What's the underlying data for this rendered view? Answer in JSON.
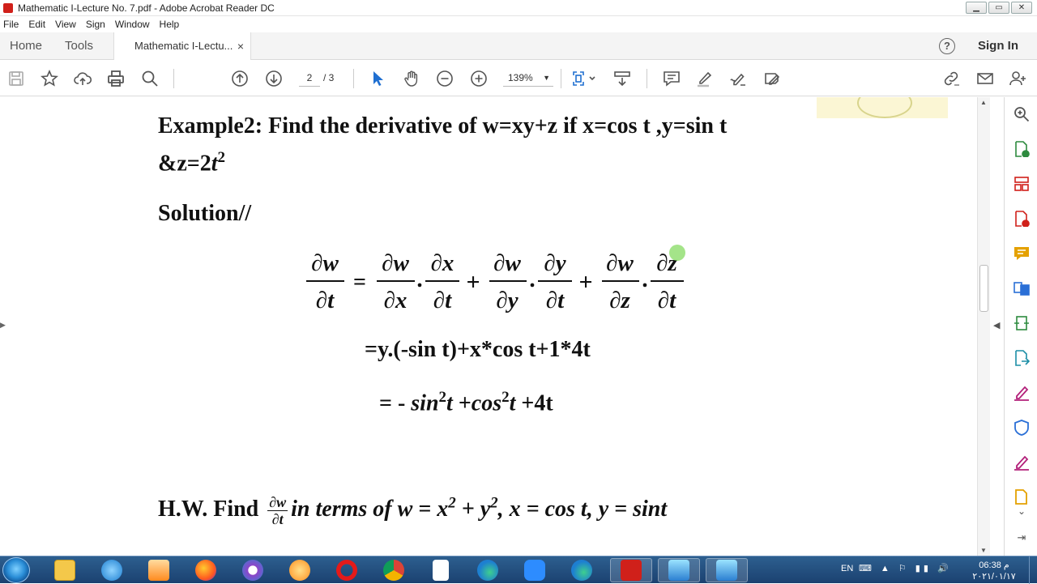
{
  "window": {
    "title": "Mathematic I-Lecture No. 7.pdf - Adobe Acrobat Reader DC",
    "controls": [
      "▁",
      "▭",
      "✕"
    ]
  },
  "menu": [
    "File",
    "Edit",
    "View",
    "Sign",
    "Window",
    "Help"
  ],
  "tabs": {
    "home": "Home",
    "tools": "Tools",
    "document": "Mathematic I-Lectu...",
    "close": "×"
  },
  "header": {
    "help": "?",
    "signin": "Sign In"
  },
  "toolbar": {
    "page_current": "2",
    "page_total": "/ 3",
    "zoom": "139%",
    "zoom_caret": "▼",
    "icons": [
      "save-icon",
      "bookmark-star-icon",
      "upload-cloud-icon",
      "print-icon",
      "search-icon",
      "page-up-icon",
      "page-down-icon",
      "select-cursor-icon",
      "hand-icon",
      "zoom-out-icon",
      "zoom-in-icon",
      "fit-page-icon",
      "scroll-mode-icon",
      "comment-icon",
      "highlight-icon",
      "sign-icon",
      "fill-sign-icon",
      "share-link-icon",
      "email-icon",
      "add-user-icon"
    ]
  },
  "document": {
    "example_line1": "Example2: Find the derivative of w=xy+z  if x=cos t ,y=sin t",
    "example_line2_prefix": "&z=2",
    "example_line2_var": "t",
    "example_line2_exp": "2",
    "solution": "Solution//",
    "equation": {
      "lhs_num": "∂w",
      "lhs_den": "∂t",
      "equals": "=",
      "t1_a_num": "∂w",
      "t1_a_den": "∂x",
      "t1_b_num": "∂x",
      "t1_b_den": "∂t",
      "t2_a_num": "∂w",
      "t2_a_den": "∂y",
      "t2_b_num": "∂y",
      "t2_b_den": "∂t",
      "t3_a_num": "∂w",
      "t3_a_den": "∂z",
      "t3_b_num": "∂z",
      "t3_b_den": "∂t",
      "plus": "+",
      "dot": "."
    },
    "result1": "=y.(-sin t)+x*cos t+1*4t",
    "result2": {
      "prefix": "= -",
      "sin": "sin",
      "sin_exp": "2",
      "t1": "t",
      "cos_prefix": "+",
      "cos": "cos",
      "cos_exp": "2",
      "t2": "t",
      "suffix": "+4t"
    },
    "hw": {
      "prefix": "H.W. Find",
      "frac_num": "∂w",
      "frac_den": "∂t",
      "text1": "in terms of w = x",
      "exp1": "2",
      "text2": " + y",
      "exp2": "2",
      "text3": ", x = cos t, y = sint"
    }
  },
  "right_panel": {
    "icons": [
      "zoom-search-icon",
      "export-pdf-icon",
      "organize-pages-icon",
      "create-pdf-icon",
      "comment-panel-icon",
      "combine-files-icon",
      "compress-icon",
      "send-review-icon",
      "fill-sign-panel-icon",
      "protect-icon",
      "edit-pdf-icon",
      "more-tools-icon"
    ],
    "colors": [
      "#555555",
      "#2d8a3e",
      "#d0201a",
      "#d0201a",
      "#e4a100",
      "#2a6fd6",
      "#2d8a3e",
      "#1c8ea6",
      "#b3207a",
      "#2a6fd6",
      "#b3207a",
      "#e4a100"
    ]
  },
  "taskbar": {
    "apps": [
      "file-explorer",
      "internet-explorer",
      "media-player",
      "firefox",
      "screen-recorder",
      "paint-app",
      "opera",
      "chrome",
      "blank-file",
      "edge",
      "zoom",
      "edge-alt",
      "acrobat",
      "remote-desktop-1",
      "remote-desktop-2"
    ],
    "lang": "EN",
    "tray": "⌨ ▲ ⚐ ▮▮ 🔊",
    "time": "06:38 م",
    "date": "٢٠٢١/٠١/١٧"
  }
}
